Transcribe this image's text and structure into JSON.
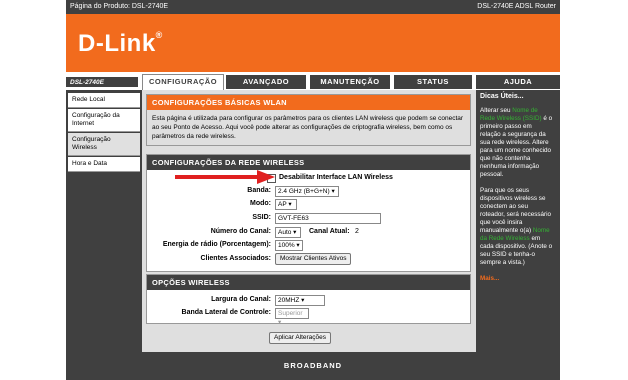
{
  "header": {
    "product": "Página do Produto: DSL-2740E",
    "router": "DSL-2740E ADSL Router"
  },
  "logo": {
    "text": "D-Link",
    "mark": "®"
  },
  "model_label": "DSL-2740E",
  "tabs": [
    {
      "label": "CONFIGURAÇÃO",
      "active": true
    },
    {
      "label": "AVANÇADO",
      "active": false
    },
    {
      "label": "MANUTENÇÃO",
      "active": false
    },
    {
      "label": "STATUS",
      "active": false
    },
    {
      "label": "AJUDA",
      "active": false
    }
  ],
  "sidebar": {
    "items": [
      {
        "label": "Rede Local",
        "selected": false
      },
      {
        "label": "Configuração da Internet",
        "selected": false
      },
      {
        "label": "Configuração Wireless",
        "selected": true
      },
      {
        "label": "Hora e Data",
        "selected": false
      }
    ]
  },
  "basic": {
    "title": "CONFIGURAÇÕES BÁSICAS WLAN",
    "desc": "Esta página é utilizada para configurar os parâmetros para os clientes LAN wireless que podem se conectar ao seu Ponto de Acesso. Aqui você pode alterar as configurações de criptografia wireless, bem como os parâmetros da rede wireless."
  },
  "network": {
    "title": "CONFIGURAÇÕES DA REDE WIRELESS",
    "disable_label": "Desabilitar Interface LAN Wireless",
    "band_label": "Banda:",
    "band_value": "2.4 GHz (B+G+N)",
    "mode_label": "Modo:",
    "mode_value": "AP",
    "ssid_label": "SSID:",
    "ssid_value": "GVT-FE63",
    "channel_label": "Número do Canal:",
    "channel_value": "Auto",
    "current_channel_label": "Canal Atual:",
    "current_channel_value": "2",
    "power_label": "Energia de rádio (Porcentagem):",
    "power_value": "100%",
    "clients_label": "Clientes Associados:",
    "clients_button": "Mostrar Clientes Ativos"
  },
  "options": {
    "title": "OPÇÕES WIRELESS",
    "width_label": "Largura do Canal:",
    "width_value": "20MHZ",
    "sideband_label": "Banda Lateral de Controle:",
    "sideband_value": "Superior"
  },
  "apply_button": "Aplicar Alterações",
  "help": {
    "title": "Dicas Úteis...",
    "p1a": "Alterar seu",
    "p1b": "Nome de Rede Wireless (SSID)",
    "p1c": "é o primeiro passo em relação a segurança da sua rede wireless. Altere para um nome conhecido que não contenha nenhuma informação pessoal.",
    "p2a": "Para que os seus dispositivos wireless se conectem ao seu roteador, será necessário que você insira manualmente o(a)",
    "p2b": "Nome da Rede Wireless",
    "p2c": "em cada dispositivo. (Anote o seu SSID e tenha-o sempre a vista.)",
    "more": "Mais..."
  },
  "footer": "BROADBAND",
  "colors": {
    "accent": "#f26b1d",
    "dark": "#404040",
    "green": "#34b233",
    "arrow": "#e02020"
  }
}
